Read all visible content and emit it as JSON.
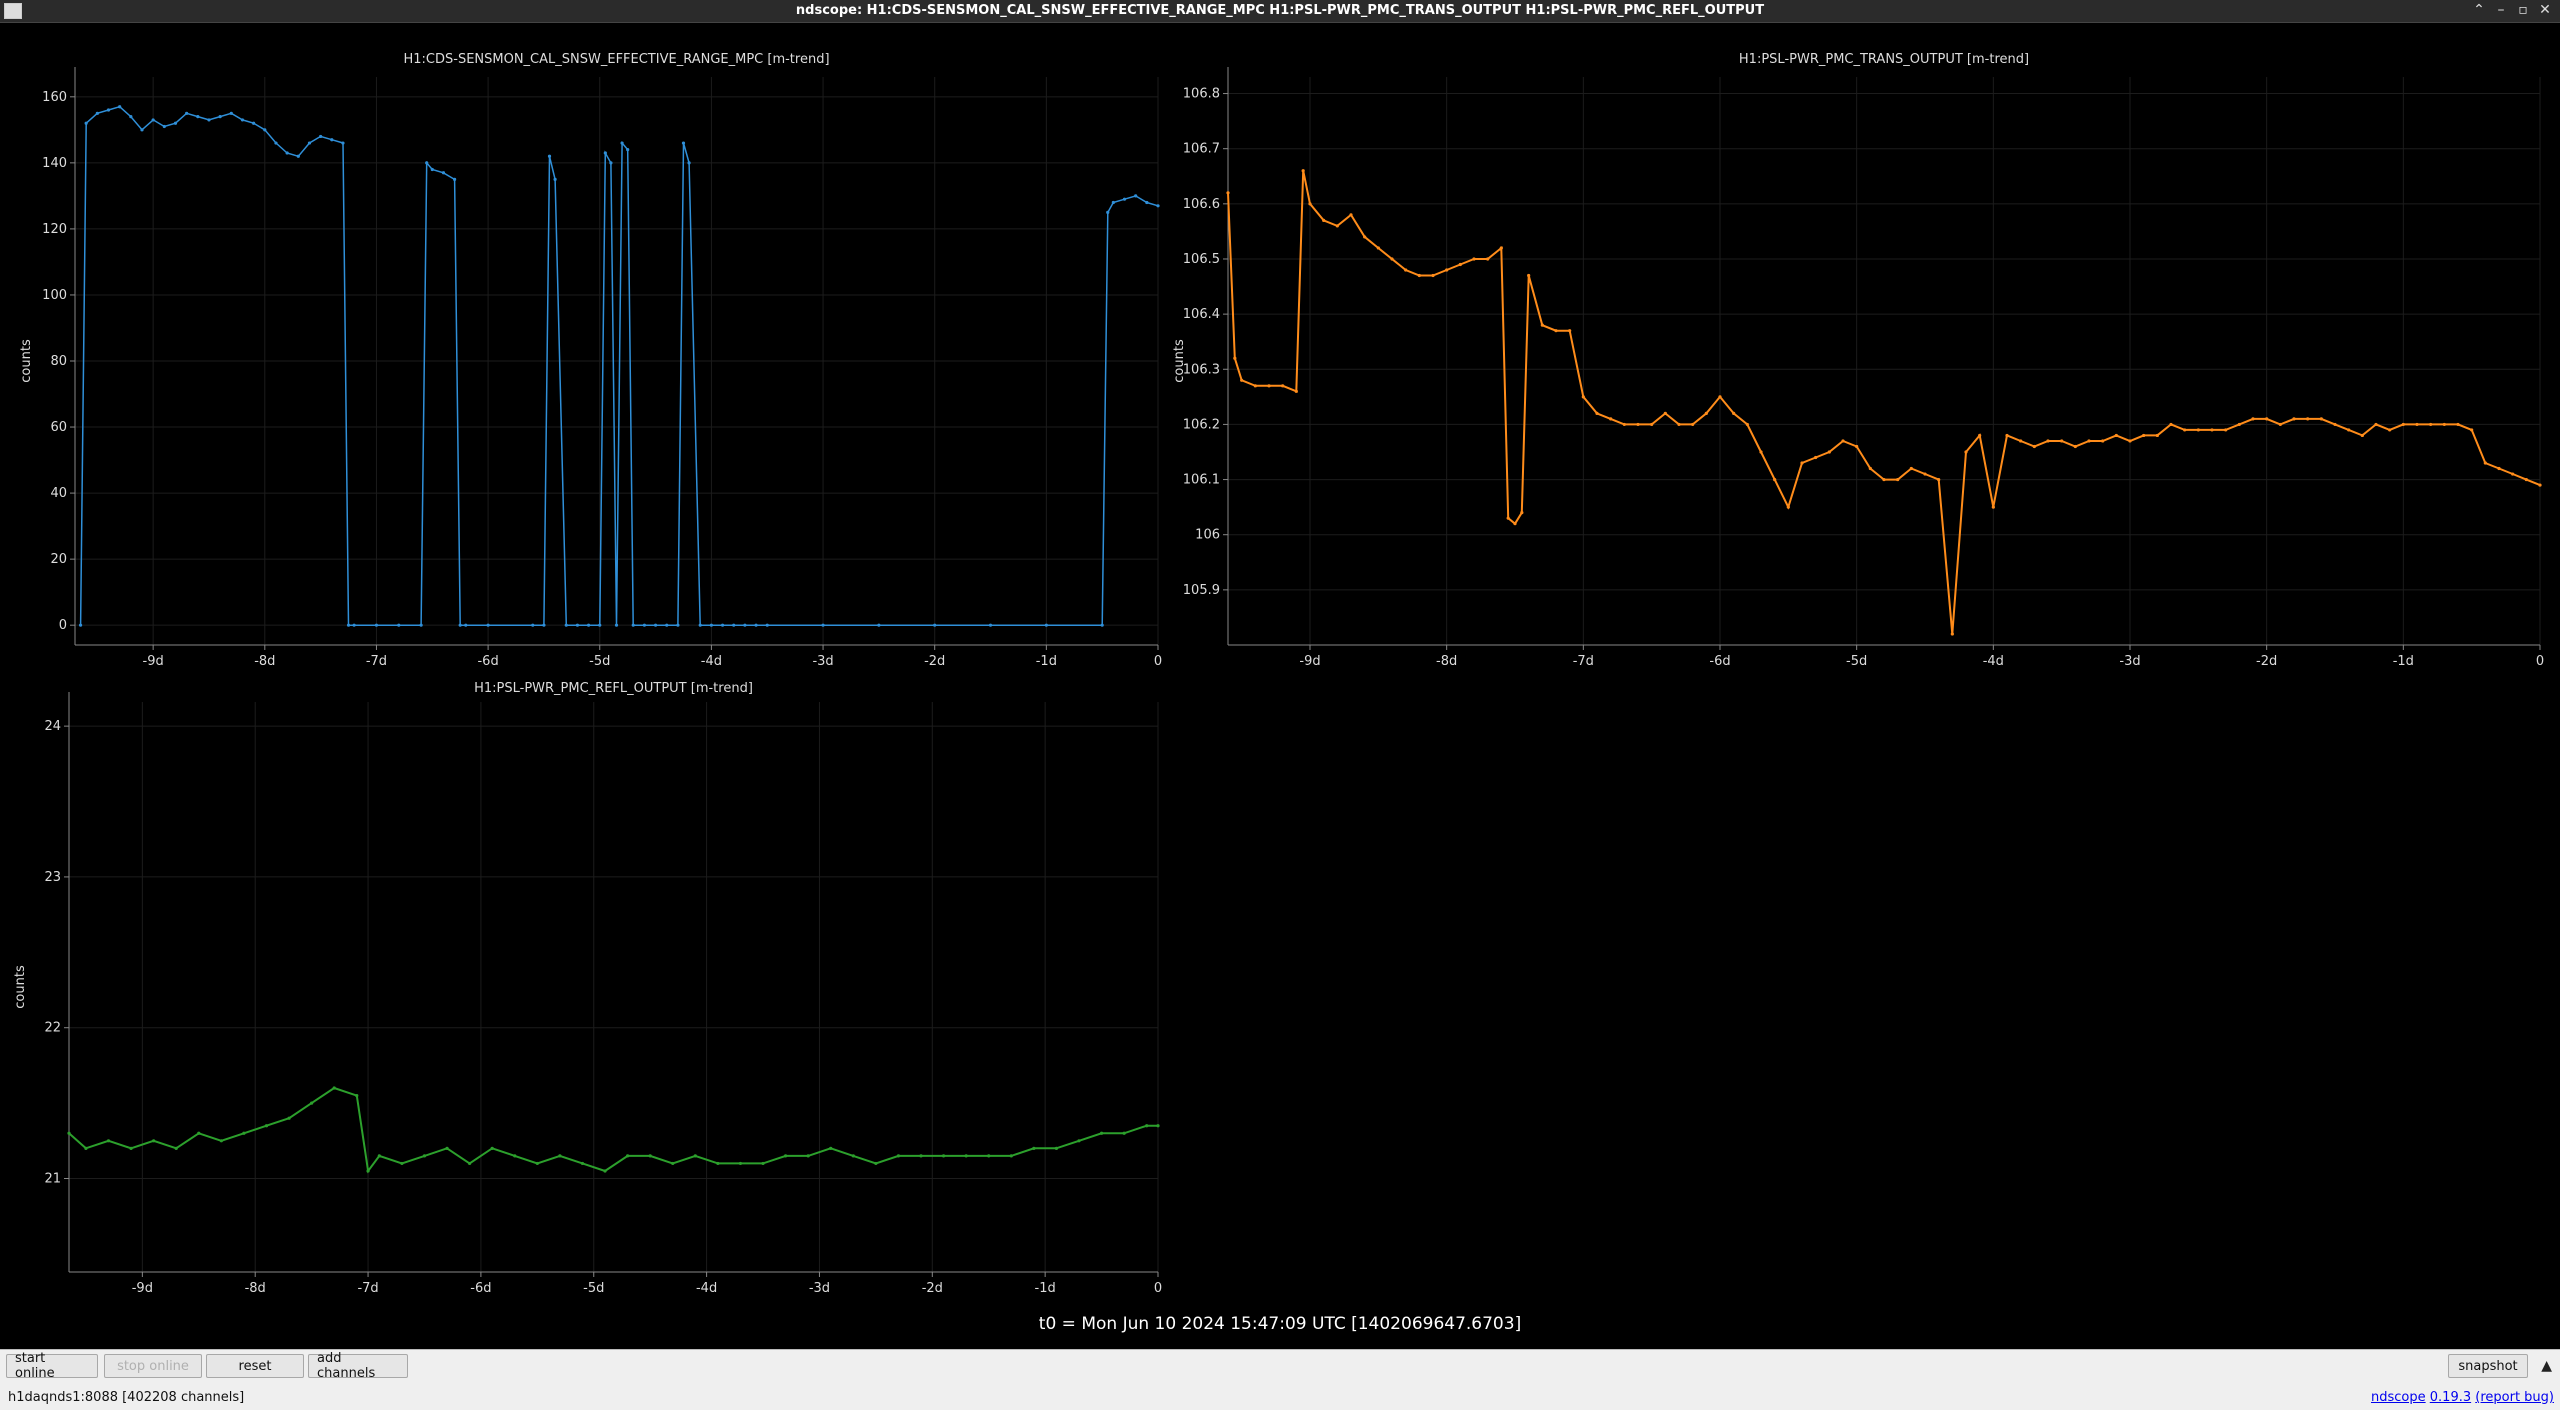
{
  "window": {
    "title": "ndscope: H1:CDS-SENSMON_CAL_SNSW_EFFECTIVE_RANGE_MPC H1:PSL-PWR_PMC_TRANS_OUTPUT H1:PSL-PWR_PMC_REFL_OUTPUT"
  },
  "t0_label": "t0 = Mon Jun 10 2024 15:47:09 UTC [1402069647.6703]",
  "toolbar": {
    "start_online": "start online",
    "stop_online": "stop online",
    "reset": "reset",
    "add_channels": "add channels",
    "snapshot": "snapshot"
  },
  "status": {
    "server": "h1daqnds1:8088  [402208 channels]",
    "app_name": "ndscope",
    "version": "0.19.3",
    "report_bug": "(report bug)"
  },
  "colors": {
    "background": "#000000",
    "range_trace": "#2f8fd8",
    "trans_trace": "#ff8c1a",
    "refl_trace": "#2ca02c"
  },
  "chart_data": [
    {
      "type": "line",
      "title": "H1:CDS-SENSMON_CAL_SNSW_EFFECTIVE_RANGE_MPC [m-trend]",
      "ylabel": "counts",
      "xlim": [
        -9.7,
        0
      ],
      "ylim": [
        -6,
        166
      ],
      "x_ticks": [
        "-9d",
        "-8d",
        "-7d",
        "-6d",
        "-5d",
        "-4d",
        "-3d",
        "-2d",
        "-1d",
        "0"
      ],
      "y_ticks": [
        0,
        20,
        40,
        60,
        80,
        100,
        120,
        140,
        160
      ],
      "grid": true,
      "series": [
        {
          "color": "#2f8fd8",
          "x": [
            -9.65,
            -9.6,
            -9.5,
            -9.4,
            -9.3,
            -9.2,
            -9.1,
            -9.0,
            -8.9,
            -8.8,
            -8.7,
            -8.6,
            -8.5,
            -8.4,
            -8.3,
            -8.2,
            -8.1,
            -8.0,
            -7.9,
            -7.8,
            -7.7,
            -7.6,
            -7.5,
            -7.4,
            -7.3,
            -7.25,
            -7.2,
            -7.0,
            -6.8,
            -6.6,
            -6.55,
            -6.5,
            -6.4,
            -6.3,
            -6.25,
            -6.2,
            -6.0,
            -5.6,
            -5.5,
            -5.45,
            -5.4,
            -5.3,
            -5.2,
            -5.1,
            -5.0,
            -4.95,
            -4.9,
            -4.85,
            -4.8,
            -4.75,
            -4.7,
            -4.6,
            -4.5,
            -4.4,
            -4.3,
            -4.25,
            -4.2,
            -4.1,
            -4.0,
            -3.9,
            -3.8,
            -3.7,
            -3.6,
            -3.5,
            -3.0,
            -2.5,
            -2.0,
            -1.5,
            -1.0,
            -0.5,
            -0.45,
            -0.4,
            -0.3,
            -0.2,
            -0.1,
            0.0
          ],
          "y": [
            0,
            152,
            155,
            156,
            157,
            154,
            150,
            153,
            151,
            152,
            155,
            154,
            153,
            154,
            155,
            153,
            152,
            150,
            146,
            143,
            142,
            146,
            148,
            147,
            146,
            0,
            0,
            0,
            0,
            0,
            140,
            138,
            137,
            135,
            0,
            0,
            0,
            0,
            0,
            142,
            135,
            0,
            0,
            0,
            0,
            143,
            140,
            0,
            146,
            144,
            0,
            0,
            0,
            0,
            0,
            146,
            140,
            0,
            0,
            0,
            0,
            0,
            0,
            0,
            0,
            0,
            0,
            0,
            0,
            0,
            125,
            128,
            129,
            130,
            128,
            127
          ]
        }
      ]
    },
    {
      "type": "line",
      "title": "H1:PSL-PWR_PMC_TRANS_OUTPUT [m-trend]",
      "ylabel": "counts",
      "xlim": [
        -9.6,
        0
      ],
      "ylim": [
        105.8,
        106.83
      ],
      "x_ticks": [
        "-9d",
        "-8d",
        "-7d",
        "-6d",
        "-5d",
        "-4d",
        "-3d",
        "-2d",
        "-1d",
        "0"
      ],
      "y_ticks": [
        105.9,
        106,
        106.1,
        106.2,
        106.3,
        106.4,
        106.5,
        106.6,
        106.7,
        106.8
      ],
      "grid": true,
      "series": [
        {
          "color": "#ff8c1a",
          "x": [
            -9.6,
            -9.55,
            -9.5,
            -9.4,
            -9.3,
            -9.2,
            -9.1,
            -9.05,
            -9.0,
            -8.9,
            -8.8,
            -8.7,
            -8.6,
            -8.5,
            -8.4,
            -8.3,
            -8.2,
            -8.1,
            -8.0,
            -7.9,
            -7.8,
            -7.7,
            -7.6,
            -7.55,
            -7.5,
            -7.45,
            -7.4,
            -7.3,
            -7.2,
            -7.1,
            -7.0,
            -6.9,
            -6.8,
            -6.7,
            -6.6,
            -6.5,
            -6.4,
            -6.3,
            -6.2,
            -6.1,
            -6.0,
            -5.9,
            -5.8,
            -5.7,
            -5.6,
            -5.5,
            -5.4,
            -5.3,
            -5.2,
            -5.1,
            -5.0,
            -4.9,
            -4.8,
            -4.7,
            -4.6,
            -4.5,
            -4.4,
            -4.3,
            -4.2,
            -4.1,
            -4.0,
            -3.9,
            -3.8,
            -3.7,
            -3.6,
            -3.5,
            -3.4,
            -3.3,
            -3.2,
            -3.1,
            -3.0,
            -2.9,
            -2.8,
            -2.7,
            -2.6,
            -2.5,
            -2.4,
            -2.3,
            -2.2,
            -2.1,
            -2.0,
            -1.9,
            -1.8,
            -1.7,
            -1.6,
            -1.5,
            -1.4,
            -1.3,
            -1.2,
            -1.1,
            -1.0,
            -0.9,
            -0.8,
            -0.7,
            -0.6,
            -0.5,
            -0.4,
            -0.3,
            -0.2,
            -0.1,
            0.0
          ],
          "y": [
            106.62,
            106.32,
            106.28,
            106.27,
            106.27,
            106.27,
            106.26,
            106.66,
            106.6,
            106.57,
            106.56,
            106.58,
            106.54,
            106.52,
            106.5,
            106.48,
            106.47,
            106.47,
            106.48,
            106.49,
            106.5,
            106.5,
            106.52,
            106.03,
            106.02,
            106.04,
            106.47,
            106.38,
            106.37,
            106.37,
            106.25,
            106.22,
            106.21,
            106.2,
            106.2,
            106.2,
            106.22,
            106.2,
            106.2,
            106.22,
            106.25,
            106.22,
            106.2,
            106.15,
            106.1,
            106.05,
            106.13,
            106.14,
            106.15,
            106.17,
            106.16,
            106.12,
            106.1,
            106.1,
            106.12,
            106.11,
            106.1,
            105.82,
            106.15,
            106.18,
            106.05,
            106.18,
            106.17,
            106.16,
            106.17,
            106.17,
            106.16,
            106.17,
            106.17,
            106.18,
            106.17,
            106.18,
            106.18,
            106.2,
            106.19,
            106.19,
            106.19,
            106.19,
            106.2,
            106.21,
            106.21,
            106.2,
            106.21,
            106.21,
            106.21,
            106.2,
            106.19,
            106.18,
            106.2,
            106.19,
            106.2,
            106.2,
            106.2,
            106.2,
            106.2,
            106.19,
            106.13,
            106.12,
            106.11,
            106.1,
            106.09
          ]
        }
      ]
    },
    {
      "type": "line",
      "title": "H1:PSL-PWR_PMC_REFL_OUTPUT [m-trend]",
      "ylabel": "counts",
      "xlim": [
        -9.65,
        0
      ],
      "ylim": [
        20.38,
        24.16
      ],
      "x_ticks": [
        "-9d",
        "-8d",
        "-7d",
        "-6d",
        "-5d",
        "-4d",
        "-3d",
        "-2d",
        "-1d",
        "0"
      ],
      "y_ticks": [
        21,
        22,
        23,
        24
      ],
      "grid": true,
      "series": [
        {
          "color": "#2ca02c",
          "x": [
            -9.65,
            -9.5,
            -9.3,
            -9.1,
            -8.9,
            -8.7,
            -8.5,
            -8.3,
            -8.1,
            -7.9,
            -7.7,
            -7.5,
            -7.3,
            -7.1,
            -7.0,
            -6.9,
            -6.7,
            -6.5,
            -6.3,
            -6.1,
            -5.9,
            -5.7,
            -5.5,
            -5.3,
            -5.1,
            -4.9,
            -4.7,
            -4.5,
            -4.3,
            -4.1,
            -3.9,
            -3.7,
            -3.5,
            -3.3,
            -3.1,
            -2.9,
            -2.7,
            -2.5,
            -2.3,
            -2.1,
            -1.9,
            -1.7,
            -1.5,
            -1.3,
            -1.1,
            -0.9,
            -0.7,
            -0.5,
            -0.3,
            -0.1,
            0.0
          ],
          "y": [
            21.3,
            21.2,
            21.25,
            21.2,
            21.25,
            21.2,
            21.3,
            21.25,
            21.3,
            21.35,
            21.4,
            21.5,
            21.6,
            21.55,
            21.05,
            21.15,
            21.1,
            21.15,
            21.2,
            21.1,
            21.2,
            21.15,
            21.1,
            21.15,
            21.1,
            21.05,
            21.15,
            21.15,
            21.1,
            21.15,
            21.1,
            21.1,
            21.1,
            21.15,
            21.15,
            21.2,
            21.15,
            21.1,
            21.15,
            21.15,
            21.15,
            21.15,
            21.15,
            21.15,
            21.2,
            21.2,
            21.25,
            21.3,
            21.3,
            21.35,
            21.35
          ]
        }
      ]
    }
  ]
}
